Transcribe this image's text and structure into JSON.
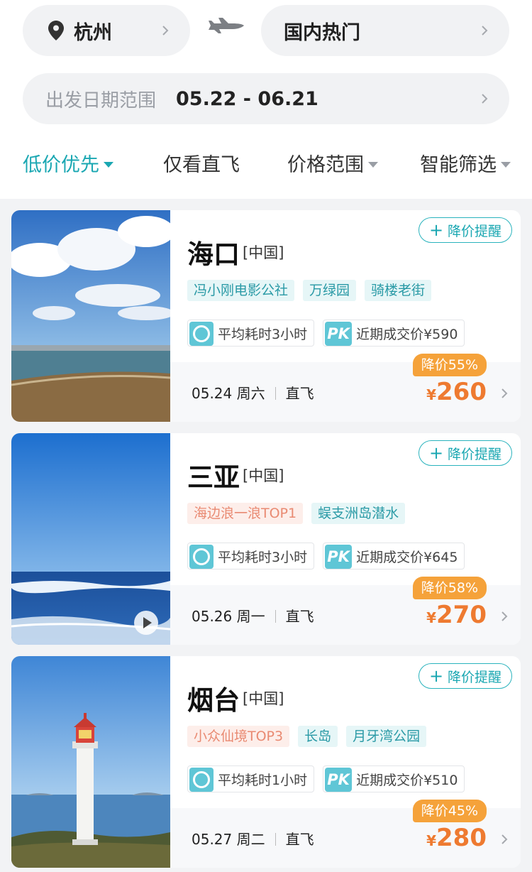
{
  "search": {
    "origin_city": "杭州",
    "destination": "国内热门",
    "date_label": "出发日期范围",
    "date_range": "05.22 - 06.21"
  },
  "filters": [
    {
      "label": "低价优先",
      "active": true,
      "has_dropdown": true
    },
    {
      "label": "仅看直飞",
      "active": false,
      "has_dropdown": false
    },
    {
      "label": "价格范围",
      "active": false,
      "has_dropdown": true
    },
    {
      "label": "智能筛选",
      "active": false,
      "has_dropdown": true
    }
  ],
  "alert_label": "降价提醒",
  "cards": [
    {
      "city": "海口",
      "country": "[中国]",
      "tags": [
        {
          "text": "冯小刚电影公社",
          "style": "teal"
        },
        {
          "text": "万绿园",
          "style": "teal"
        },
        {
          "text": "骑楼老街",
          "style": "teal"
        }
      ],
      "duration": "平均耗时3小时",
      "recent_price": "近期成交价¥590",
      "date": "05.24 周六",
      "flight_type": "直飞",
      "discount": "降价55%",
      "currency": "¥",
      "price": "260",
      "photo": "beach-clouds",
      "has_video": false
    },
    {
      "city": "三亚",
      "country": "[中国]",
      "tags": [
        {
          "text": "海边浪一浪TOP1",
          "style": "orange"
        },
        {
          "text": "蜈支洲岛潜水",
          "style": "teal"
        }
      ],
      "duration": "平均耗时3小时",
      "recent_price": "近期成交价¥645",
      "date": "05.26 周一",
      "flight_type": "直飞",
      "discount": "降价58%",
      "currency": "¥",
      "price": "270",
      "photo": "ocean-waves",
      "has_video": true
    },
    {
      "city": "烟台",
      "country": "[中国]",
      "tags": [
        {
          "text": "小众仙境TOP3",
          "style": "orange"
        },
        {
          "text": "长岛",
          "style": "teal"
        },
        {
          "text": "月牙湾公园",
          "style": "teal"
        }
      ],
      "duration": "平均耗时1小时",
      "recent_price": "近期成交价¥510",
      "date": "05.27 周二",
      "flight_type": "直飞",
      "discount": "降价45%",
      "currency": "¥",
      "price": "280",
      "photo": "lighthouse",
      "has_video": false
    }
  ],
  "colors": {
    "accent": "#1aa7b2",
    "price": "#ee7a30",
    "discount_badge": "#f5a23a",
    "tag_teal_bg": "#e6f6f7",
    "tag_orange_bg": "#fdeeea"
  }
}
